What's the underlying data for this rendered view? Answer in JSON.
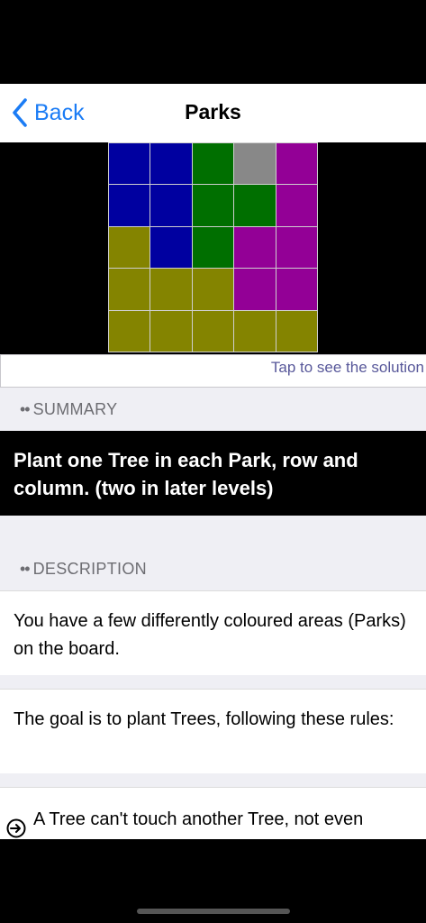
{
  "nav": {
    "back_label": "Back",
    "title": "Parks"
  },
  "puzzle": {
    "rows": [
      [
        "#0000a0",
        "#0000a0",
        "#006f00",
        "#888888",
        "#930096"
      ],
      [
        "#0000a0",
        "#0000a0",
        "#006f00",
        "#006f00",
        "#930096"
      ],
      [
        "#848400",
        "#0000a0",
        "#006f00",
        "#930096",
        "#930096"
      ],
      [
        "#848400",
        "#848400",
        "#848400",
        "#930096",
        "#930096"
      ],
      [
        "#848400",
        "#848400",
        "#848400",
        "#848400",
        "#848400"
      ]
    ]
  },
  "solution_hint": "Tap to see the solution",
  "summary": {
    "header": "SUMMARY",
    "text": "Plant one Tree in each Park, row and column. (two in later levels)"
  },
  "description": {
    "header": "DESCRIPTION",
    "paragraph1": "You have a few differently coloured areas (Parks) on the board.",
    "paragraph2": "The goal is to plant Trees, following these rules:",
    "rule1": "A Tree can't touch another Tree, not even diagonally."
  },
  "header_dots": "••"
}
